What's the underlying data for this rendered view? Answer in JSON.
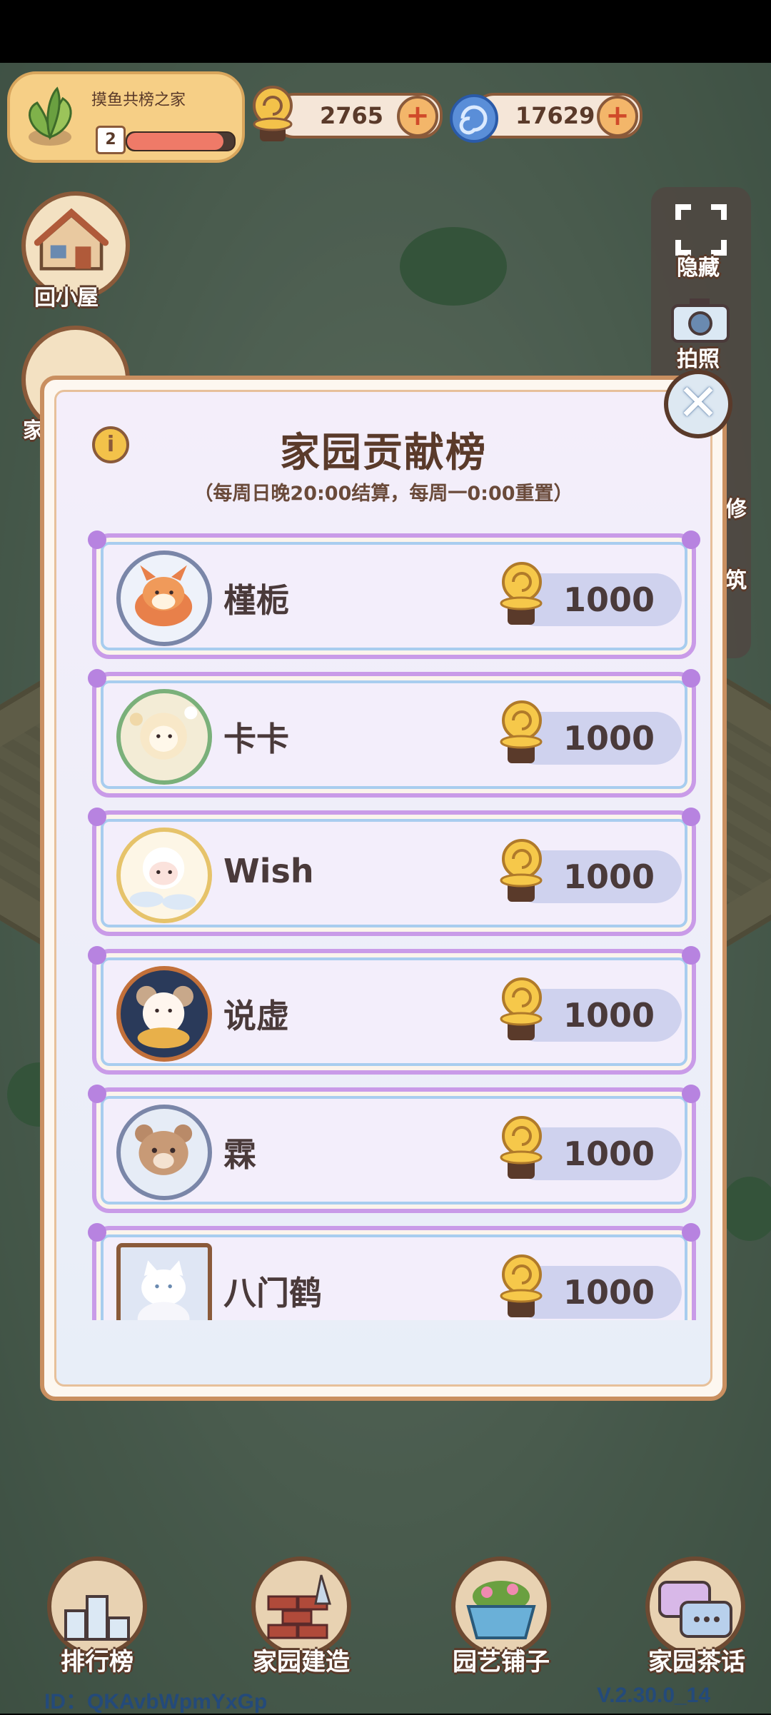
{
  "header": {
    "home_name": "摸鱼共榜之家",
    "level": "2",
    "level_progress": 0.9
  },
  "currencies": [
    {
      "icon": "golden-snail-icon",
      "value": "2765"
    },
    {
      "icon": "blue-swirl-gem-icon",
      "value": "17629"
    }
  ],
  "left_buttons": {
    "home": "回小屋",
    "gift_partial": "家"
  },
  "right_panel": {
    "hide": "隐藏",
    "photo": "拍照",
    "partial_1": "修",
    "partial_2": "筑"
  },
  "modal": {
    "title": "家园贡献榜",
    "subtitle": "（每周日晚20:00结算，每周一0:00重置）",
    "info_icon": "i",
    "close_icon": "✕",
    "entries": [
      {
        "name": "槿栀",
        "score": "1000",
        "avatar": "fox"
      },
      {
        "name": "卡卡",
        "score": "1000",
        "avatar": "sheep-flower"
      },
      {
        "name": "Wish",
        "score": "1000",
        "avatar": "sheep-cloud"
      },
      {
        "name": "说虚",
        "score": "1000",
        "avatar": "mouse-scarf"
      },
      {
        "name": "霖",
        "score": "1000",
        "avatar": "bear"
      },
      {
        "name": "八门鹤",
        "score": "1000",
        "avatar": "white-cat"
      }
    ]
  },
  "bottom_nav": [
    {
      "label": "排行榜",
      "icon": "podium-icon"
    },
    {
      "label": "家园建造",
      "icon": "bricks-trowel-icon"
    },
    {
      "label": "园艺铺子",
      "icon": "flower-basket-icon"
    },
    {
      "label": "家园茶话",
      "icon": "chat-bubbles-icon"
    }
  ],
  "footer": {
    "id": "ID：QKAvbWpmYxGp",
    "version": "V.2.30.0_14"
  },
  "colors": {
    "modal_border": "#c98f60",
    "row_border": "#c99be8",
    "score_pill": "#cfd2ee",
    "text_brown": "#5a3a2a"
  }
}
